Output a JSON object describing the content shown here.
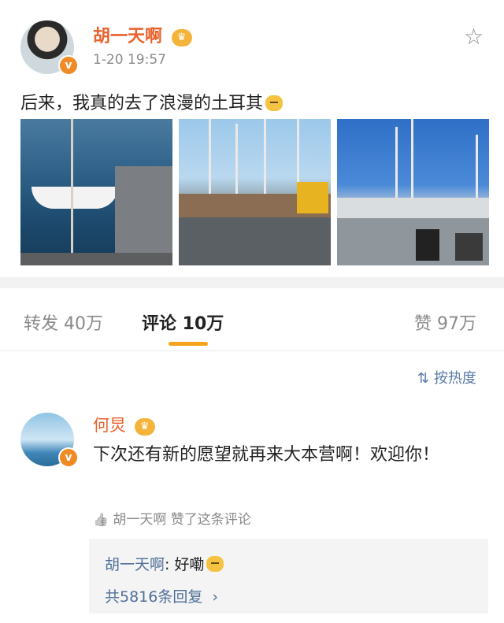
{
  "post": {
    "username": "胡一天啊",
    "time": "1-20 19:57",
    "text": "后来，我真的去了浪漫的土耳其",
    "verified_mark": "v",
    "crown_mark": "♛",
    "star_icon": "☆"
  },
  "tabs": {
    "repost": "转发 40万",
    "comment": "评论 10万",
    "like": "赞 97万"
  },
  "sort": {
    "label": "按热度",
    "icon": "⇅"
  },
  "comment": {
    "username": "何炅",
    "text": "下次还有新的愿望就再来大本营啊！欢迎你！",
    "liked_by": "胡一天啊 赞了这条评论",
    "thumb_icon": "👍"
  },
  "reply": {
    "name": "胡一天啊",
    "colon": ": ",
    "text": "好嘞",
    "count": "共5816条回复",
    "chevron": "›"
  },
  "colors": {
    "accent_orange": "#e8622d",
    "tab_indicator": "#f7a21b",
    "link_blue": "#4e6f98"
  }
}
